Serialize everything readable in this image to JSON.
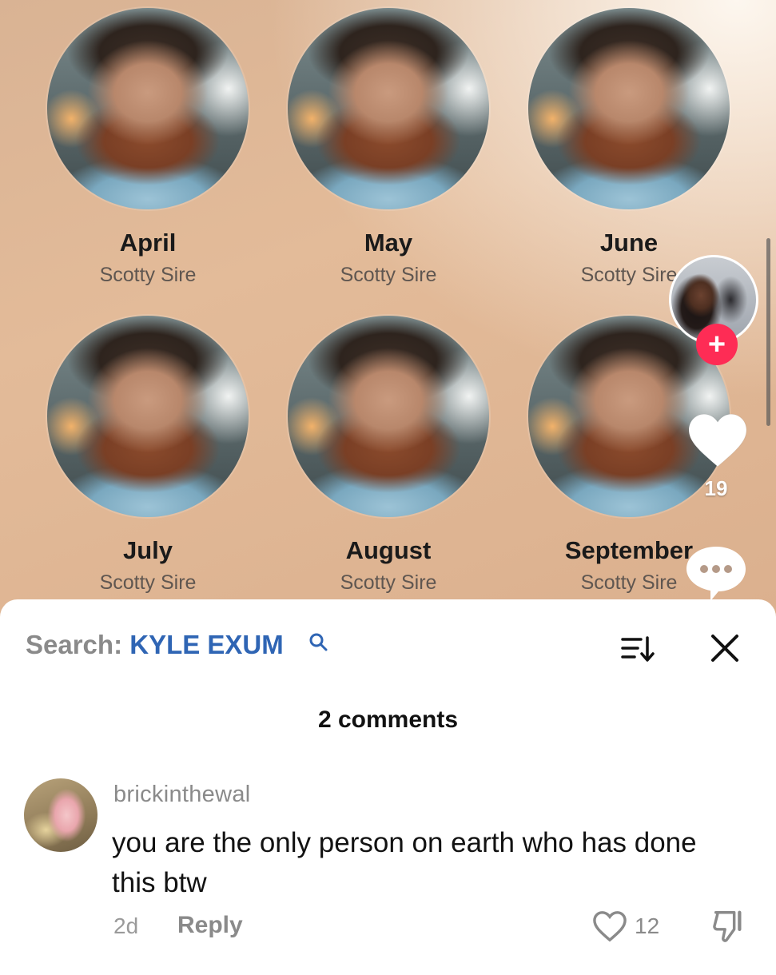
{
  "grid": [
    {
      "title": "April",
      "artist": "Scotty Sire"
    },
    {
      "title": "May",
      "artist": "Scotty Sire"
    },
    {
      "title": "June",
      "artist": "Scotty Sire"
    },
    {
      "title": "July",
      "artist": "Scotty Sire"
    },
    {
      "title": "August",
      "artist": "Scotty Sire"
    },
    {
      "title": "September",
      "artist": "Scotty Sire"
    }
  ],
  "sidebar": {
    "follow_symbol": "+",
    "like_count": "19"
  },
  "search": {
    "prefix": "Search:",
    "term": "KYLE EXUM"
  },
  "comments": {
    "count_label": "2 comments",
    "items": [
      {
        "username": "brickinthewal",
        "text": "you are the only person on earth who has done this btw",
        "time": "2d",
        "reply_label": "Reply",
        "likes": "12"
      }
    ]
  },
  "colors": {
    "accent_red": "#fe2c55",
    "search_blue": "#2f65b4"
  },
  "icons": [
    "search-icon",
    "sort-icon",
    "close-icon",
    "heart-icon",
    "comment-icon",
    "dislike-icon",
    "plus-icon"
  ]
}
